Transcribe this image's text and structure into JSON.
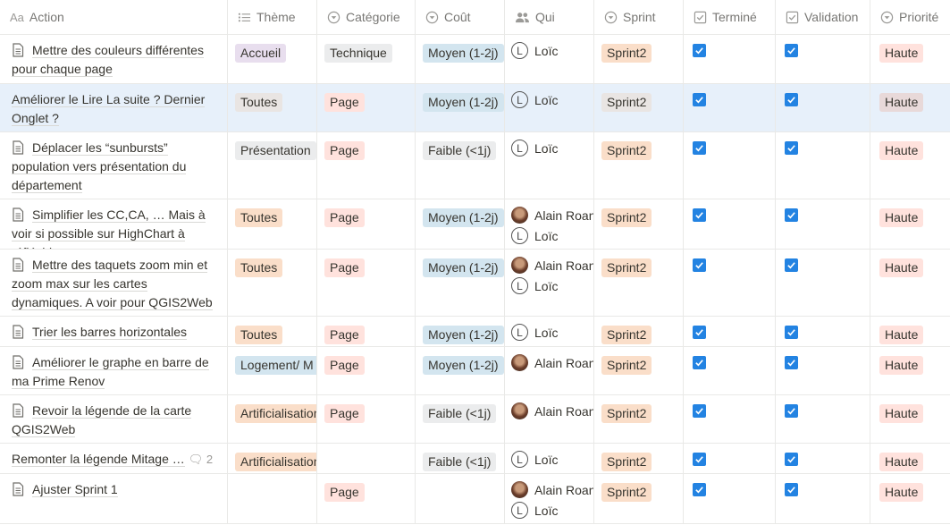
{
  "columns": [
    {
      "label": "Action",
      "icon": "title-icon"
    },
    {
      "label": "Thème",
      "icon": "list-icon"
    },
    {
      "label": "Catégorie",
      "icon": "select-icon"
    },
    {
      "label": "Coût",
      "icon": "select-icon"
    },
    {
      "label": "Qui",
      "icon": "people-icon"
    },
    {
      "label": "Sprint",
      "icon": "select-icon"
    },
    {
      "label": "Terminé",
      "icon": "checkbox-icon"
    },
    {
      "label": "Validation",
      "icon": "checkbox-icon"
    },
    {
      "label": "Priorité",
      "icon": "select-icon"
    }
  ],
  "title_prefix": "Aa",
  "colors": {
    "checkbox": "#2383e2",
    "selected_row": "#e7f0fa"
  },
  "rows": [
    {
      "action": "Mettre des couleurs différentes pour chaque page",
      "doc": true,
      "theme": "Accueil",
      "theme_color": "purple",
      "categorie": "Technique",
      "cat_color": "gray",
      "cout": "Moyen (1-2j)",
      "cout_color": "blue",
      "qui": [
        {
          "name": "Loïc",
          "type": "letter",
          "initial": "L"
        }
      ],
      "sprint": "Sprint2",
      "sprint_color": "orange",
      "termine": true,
      "validation": true,
      "priorite": "Haute"
    },
    {
      "action": "Améliorer le Lire La suite ? Dernier Onglet ?",
      "doc": false,
      "selected": true,
      "theme": "Toutes",
      "theme_color": "brown",
      "categorie": "Page",
      "cat_color": "red",
      "cout": "Moyen (1-2j)",
      "cout_color": "blue",
      "qui": [
        {
          "name": "Loïc",
          "type": "letter",
          "initial": "L"
        }
      ],
      "sprint": "Sprint2",
      "sprint_color": "brown",
      "termine": true,
      "validation": true,
      "priorite": "Haute",
      "prio_color": "brownred"
    },
    {
      "action": "Déplacer les “sunbursts” population vers présentation du département",
      "doc": true,
      "theme": "Présentation",
      "theme_color": "gray",
      "categorie": "Page",
      "cat_color": "red",
      "cout": "Faible (<1j)",
      "cout_color": "gray",
      "qui": [
        {
          "name": "Loïc",
          "type": "letter",
          "initial": "L"
        }
      ],
      "sprint": "Sprint2",
      "sprint_color": "orange",
      "termine": true,
      "validation": true,
      "priorite": "Haute"
    },
    {
      "action": "Simplifier les CC,CA, … Mais à voir si possible sur HighChart à réfléchir",
      "doc": true,
      "theme": "Toutes",
      "theme_color": "orange",
      "categorie": "Page",
      "cat_color": "red",
      "cout": "Moyen (1-2j)",
      "cout_color": "blue",
      "qui": [
        {
          "name": "Alain Roan",
          "type": "photo"
        },
        {
          "name": "Loïc",
          "type": "letter",
          "initial": "L"
        }
      ],
      "sprint": "Sprint2",
      "sprint_color": "orange",
      "termine": true,
      "validation": true,
      "priorite": "Haute"
    },
    {
      "action": "Mettre des taquets zoom min et zoom max sur les cartes dynamiques. A voir pour QGIS2Web",
      "doc": true,
      "theme": "Toutes",
      "theme_color": "orange",
      "categorie": "Page",
      "cat_color": "red",
      "cout": "Moyen (1-2j)",
      "cout_color": "blue",
      "qui": [
        {
          "name": "Alain Roan",
          "type": "photo"
        },
        {
          "name": "Loïc",
          "type": "letter",
          "initial": "L"
        }
      ],
      "sprint": "Sprint2",
      "sprint_color": "orange",
      "termine": true,
      "validation": true,
      "priorite": "Haute"
    },
    {
      "action": "Trier les barres horizontales",
      "doc": true,
      "theme": "Toutes",
      "theme_color": "orange",
      "categorie": "Page",
      "cat_color": "red",
      "cout": "Moyen (1-2j)",
      "cout_color": "blue",
      "qui": [
        {
          "name": "Loïc",
          "type": "letter",
          "initial": "L"
        }
      ],
      "sprint": "Sprint2",
      "sprint_color": "orange",
      "termine": true,
      "validation": true,
      "priorite": "Haute"
    },
    {
      "action": "Améliorer le graphe en barre de ma Prime Renov",
      "doc": true,
      "theme": "Logement/ M",
      "theme_color": "blue",
      "categorie": "Page",
      "cat_color": "red",
      "cout": "Moyen (1-2j)",
      "cout_color": "blue",
      "qui": [
        {
          "name": "Alain Roan",
          "type": "photo"
        }
      ],
      "sprint": "Sprint2",
      "sprint_color": "orange",
      "termine": true,
      "validation": true,
      "priorite": "Haute"
    },
    {
      "action": "Revoir la légende de la carte QGIS2Web",
      "doc": true,
      "theme": "Artificialisation",
      "theme_color": "orange",
      "categorie": "Page",
      "cat_color": "red",
      "cout": "Faible (<1j)",
      "cout_color": "gray",
      "qui": [
        {
          "name": "Alain Roan",
          "type": "photo"
        }
      ],
      "sprint": "Sprint2",
      "sprint_color": "orange",
      "termine": true,
      "validation": true,
      "priorite": "Haute"
    },
    {
      "action": "Remonter la légende Mitage …",
      "doc": false,
      "comments": "2",
      "theme": "Artificialisation",
      "theme_color": "orange",
      "categorie": "",
      "cat_color": "red",
      "cout": "Faible (<1j)",
      "cout_color": "gray",
      "qui": [
        {
          "name": "Loïc",
          "type": "letter",
          "initial": "L"
        }
      ],
      "sprint": "Sprint2",
      "sprint_color": "orange",
      "termine": true,
      "validation": true,
      "priorite": "Haute"
    },
    {
      "action": "Ajuster Sprint 1",
      "doc": true,
      "theme": "",
      "theme_color": "orange",
      "categorie": "Page",
      "cat_color": "red",
      "cout": "",
      "cout_color": "gray",
      "qui": [
        {
          "name": "Alain Roan",
          "type": "photo"
        },
        {
          "name": "Loïc",
          "type": "letter",
          "initial": "L"
        }
      ],
      "sprint": "Sprint2",
      "sprint_color": "orange",
      "termine": true,
      "validation": true,
      "priorite": "Haute"
    }
  ]
}
